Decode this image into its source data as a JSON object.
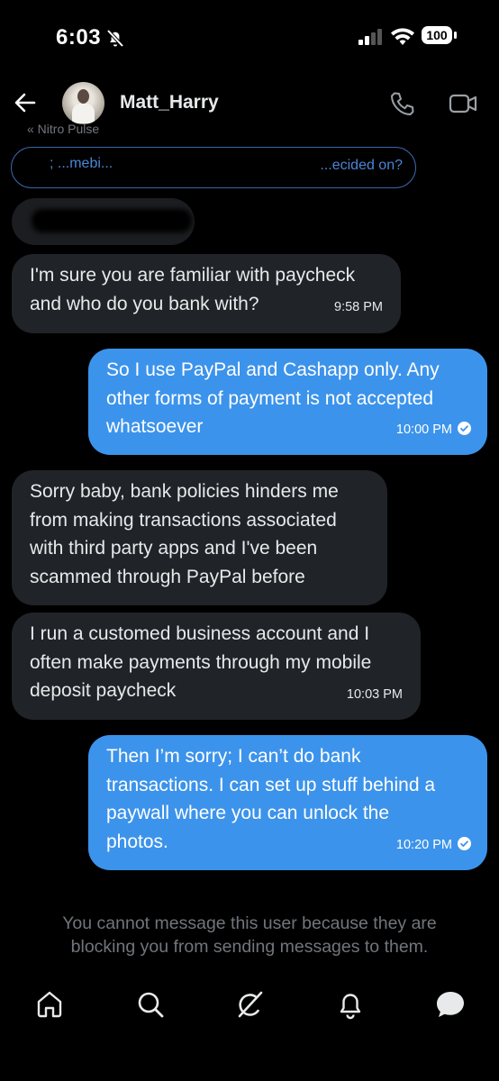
{
  "status_bar": {
    "time": "6:03",
    "battery": "100"
  },
  "header": {
    "contact_name": "Matt_Harry"
  },
  "thread": {
    "nitro_snippet": "« Nitro Pulse",
    "quoted_lead": "; ...mebi...",
    "quoted_tail": "...ecided on?"
  },
  "messages": [
    {
      "from": "them",
      "text": "I'm sure you are familiar with paycheck\nand who do you bank with?",
      "time": "9:58 PM"
    },
    {
      "from": "me",
      "text": "So I use PayPal and Cashapp only. Any\nother forms of payment is not accepted\nwhatsoever",
      "time": "10:00 PM"
    },
    {
      "from": "them",
      "text": "Sorry baby, bank policies hinders me\nfrom making transactions associated\nwith third party apps and I've been\nscammed through PayPal before"
    },
    {
      "from": "them",
      "text": "I run a customed business account and I\noften make payments through my mobile\ndeposit paycheck",
      "time": "10:03 PM"
    },
    {
      "from": "me",
      "text": "Then I’m sorry; I can’t do bank\ntransactions. I can set up stuff behind a\npaywall where you can unlock the\nphotos.",
      "time": "10:20 PM"
    }
  ],
  "blocked_notice": "You cannot message this user because they are\nblocking you from sending messages to them.",
  "icons": {
    "mute": "bell-slash-icon",
    "signal": "cellular-signal-icon",
    "wifi": "wifi-icon",
    "back": "back-arrow-icon",
    "phone": "phone-icon",
    "video": "video-camera-icon",
    "home": "home-icon",
    "search": "search-icon",
    "grok": "grok-icon",
    "notifications": "bell-icon",
    "messages": "messages-icon"
  },
  "colors": {
    "background": "#000000",
    "sent_bubble": "#3c93eb",
    "received_bubble": "#202327",
    "muted_text": "#71767b"
  }
}
